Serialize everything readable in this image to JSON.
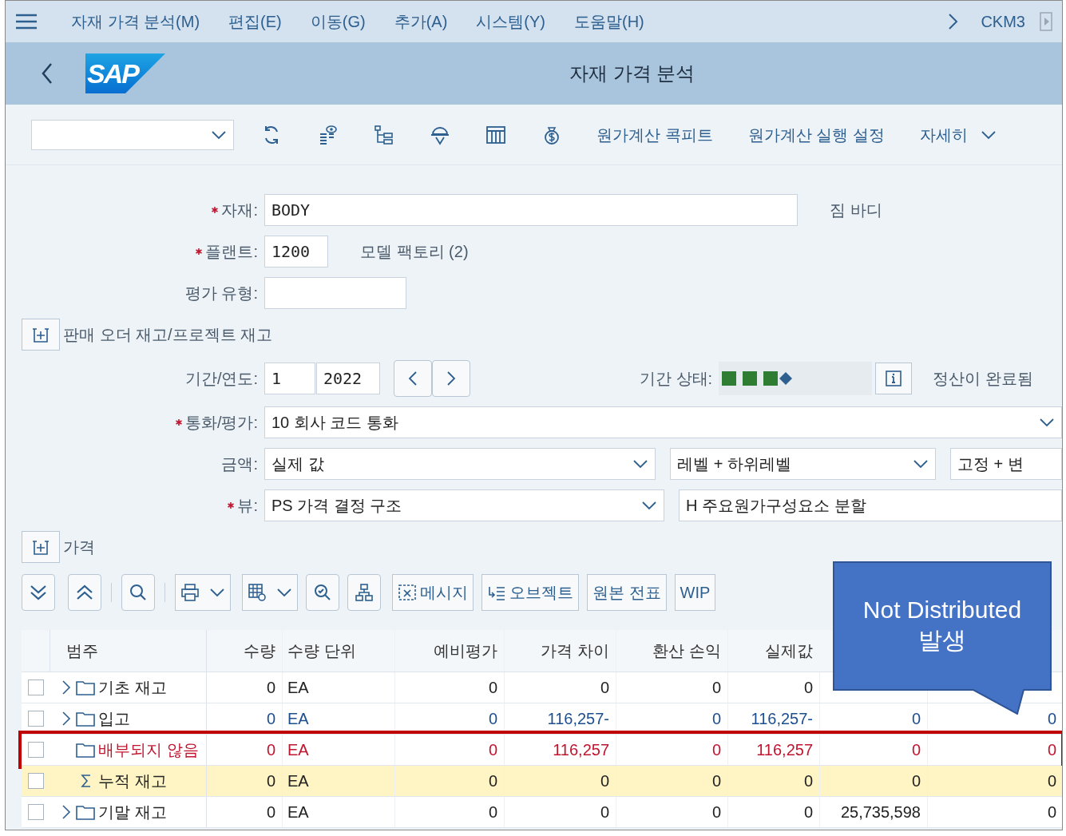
{
  "menu_bar": {
    "items": [
      "자재 가격 분석(M)",
      "편집(E)",
      "이동(G)",
      "추가(A)",
      "시스템(Y)",
      "도움말(H)"
    ],
    "transaction": "CKM3"
  },
  "header": {
    "logo": "SAP",
    "title": "자재 가격 분석"
  },
  "toolbar": {
    "buttons": [
      "원가계산 콕피트",
      "원가계산 실행 설정"
    ],
    "more": "자세히"
  },
  "form": {
    "material": {
      "label": "자재:",
      "required": true,
      "value": "BODY",
      "description": "짐 바디"
    },
    "plant": {
      "label": "플랜트:",
      "required": true,
      "value": "1200",
      "description": "모델 팩토리 (2)"
    },
    "valuation_type": {
      "label": "평가 유형:",
      "required": false
    },
    "sales_order_stock": {
      "label": "판매 오더 재고/프로젝트 재고"
    },
    "period": {
      "label": "기간/연도:",
      "period": "1",
      "year": "2022"
    },
    "period_status": {
      "label": "기간 상태:",
      "text": "정산이 완료됨"
    },
    "currency": {
      "label": "통화/평가:",
      "required": true,
      "value": "10 회사 코드 통화"
    },
    "amount": {
      "label": "금액:",
      "required": false,
      "values": [
        "실제 값",
        "레벨 + 하위레벨",
        "고정 + 변"
      ]
    },
    "view": {
      "label": "뷰:",
      "required": true,
      "value": "PS 가격 결정 구조",
      "value2": "H 주요원가구성요소 분할"
    }
  },
  "prices_section": {
    "label": "가격"
  },
  "table_toolbar": {
    "text_buttons": [
      "메시지",
      "오브젝트",
      "원본 전표",
      "WIP"
    ]
  },
  "table": {
    "columns": [
      "범주",
      "수량",
      "수량 단위",
      "예비평가",
      "가격 차이",
      "환산 손익",
      "실제값"
    ],
    "rows": [
      {
        "kind": "plain",
        "expandable": true,
        "checked": false,
        "highlighted": false,
        "cells": [
          "기초 재고",
          "0",
          "EA",
          "0",
          "0",
          "0",
          "0",
          null,
          null
        ]
      },
      {
        "kind": "linked",
        "expandable": true,
        "checked": false,
        "highlighted": false,
        "cells": [
          "입고",
          "0",
          "EA",
          "0",
          "116,257-",
          "0",
          "116,257-",
          "0",
          "0"
        ]
      },
      {
        "kind": "error",
        "expandable": false,
        "checked": false,
        "highlighted": true,
        "cells": [
          "배부되지 않음",
          "0",
          "EA",
          "0",
          "116,257",
          "0",
          "116,257",
          "0",
          "0"
        ]
      },
      {
        "kind": "total",
        "expandable": false,
        "checked": false,
        "highlighted": false,
        "cells": [
          "누적 재고",
          "0",
          "EA",
          "0",
          "0",
          "0",
          "0",
          "0",
          "0"
        ]
      },
      {
        "kind": "plain",
        "expandable": true,
        "checked": false,
        "highlighted": false,
        "cells": [
          "기말 재고",
          "0",
          "EA",
          "0",
          "0",
          "0",
          "0",
          "25,735,598",
          "0"
        ]
      }
    ]
  },
  "callout": {
    "text": "Not Distributed\n발생"
  }
}
